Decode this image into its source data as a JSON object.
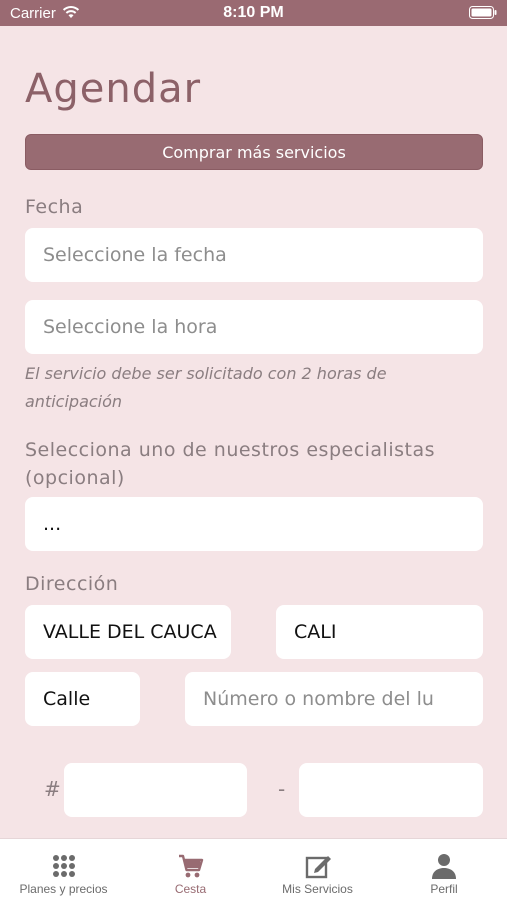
{
  "status_bar": {
    "carrier": "Carrier",
    "time": "8:10 PM"
  },
  "page": {
    "title": "Agendar",
    "buy_button": "Comprar más servicios",
    "date_label": "Fecha",
    "date_placeholder": "Seleccione la fecha",
    "time_placeholder": "Seleccione la hora",
    "time_note": "El servicio debe ser solicitado con 2 horas de anticipación",
    "specialist_label": "Selecciona uno de nuestros especialistas (opcional)",
    "specialist_value": "...",
    "address_label": "Dirección",
    "department_value": "VALLE DEL CAUCA",
    "city_value": "CALI",
    "street_type_value": "Calle",
    "place_placeholder": "Número o nombre del lu",
    "hash_symbol": "#",
    "dash_symbol": "-"
  },
  "tab_bar": {
    "items": [
      {
        "label": "Planes y precios",
        "icon": "grid-icon",
        "active": false
      },
      {
        "label": "Cesta",
        "icon": "cart-icon",
        "active": true
      },
      {
        "label": "Mis Servicios",
        "icon": "edit-icon",
        "active": false
      },
      {
        "label": "Perfil",
        "icon": "person-icon",
        "active": false
      }
    ]
  },
  "colors": {
    "accent": "#986b72",
    "background": "#f5e4e6",
    "title": "#8c6168"
  }
}
